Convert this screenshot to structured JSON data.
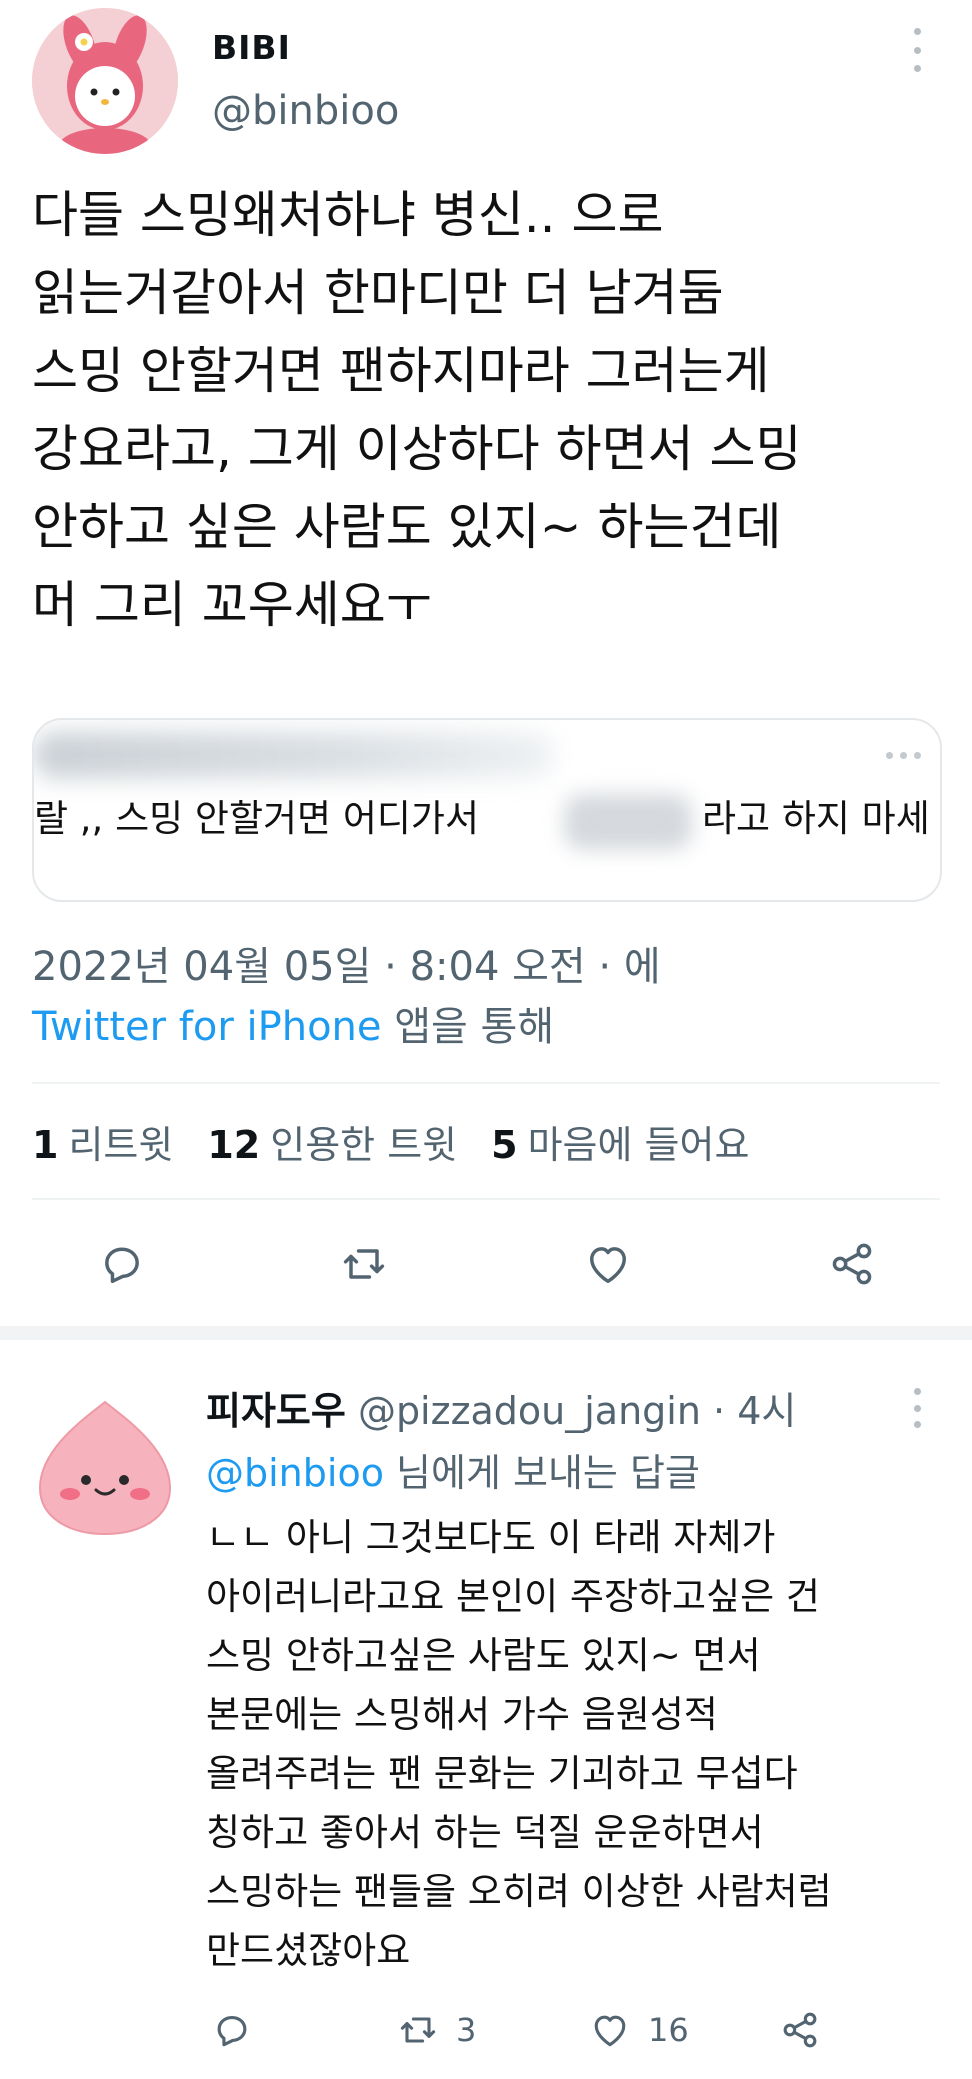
{
  "tweet": {
    "display_name": "BIBI",
    "handle": "@binbioo",
    "text_lines": [
      "다들 스밍왜처하냐 병신.. 으로",
      "읽는거같아서 한마디만 더 남겨둠",
      "스밍 안할거면 팬하지마라 그러는게",
      "강요라고, 그게 이상하다 하면서 스밍",
      "안하고 싶은 사람도 있지~ 하는건데",
      "머 그리 꼬우세요ㅜ"
    ],
    "quote": {
      "visible_text_left": "랄 ,, 스밍 안할거면 어디가서",
      "visible_text_right": "라고 하지 마세"
    },
    "timestamp": "2022년 04월 05일 · 8:04 오전 · 에",
    "source_link": "Twitter for iPhone",
    "source_suffix": " 앱을 통해",
    "stats": {
      "retweets_count": "1",
      "retweets_label": "리트윗",
      "quotes_count": "12",
      "quotes_label": "인용한 트윗",
      "likes_count": "5",
      "likes_label": "마음에 들어요"
    }
  },
  "reply": {
    "display_name": "피자도우",
    "handle": "@pizzadou_jangin",
    "separator": " · ",
    "time": "4시",
    "replying_mention": "@binbioo",
    "replying_rest": " 님에게 보내는 답글",
    "text_lines": [
      "ㄴㄴ 아니 그것보다도 이 타래 자체가",
      "아이러니라고요 본인이 주장하고싶은 건",
      "스밍 안하고싶은 사람도 있지~ 면서",
      "본문에는 스밍해서 가수 음원성적",
      "올려주려는 팬 문화는 기괴하고 무섭다",
      "칭하고 좋아서 하는 덕질 운운하면서",
      "스밍하는 팬들을 오히려 이상한 사람처럼",
      "만드셨잖아요"
    ],
    "retweet_count": "3",
    "like_count": "16"
  },
  "colors": {
    "link": "#1d9bf0",
    "secondary_text": "#536471",
    "divider": "#eff3f4"
  },
  "icons": [
    "more-vertical-icon",
    "reply-icon",
    "retweet-icon",
    "like-icon",
    "share-icon",
    "more-horizontal-icon"
  ]
}
